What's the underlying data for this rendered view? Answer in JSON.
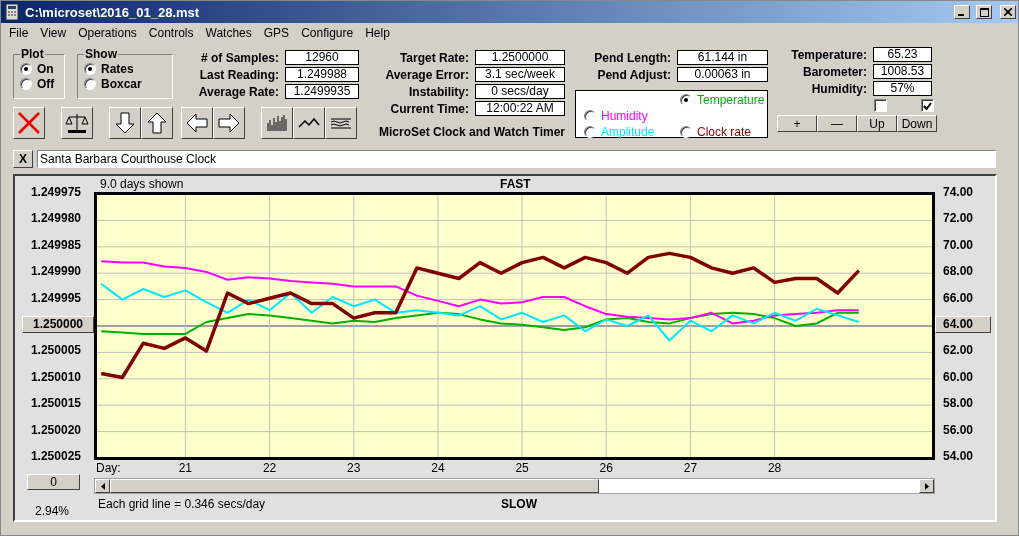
{
  "window": {
    "title": "C:\\microset\\2016_01_28.mst"
  },
  "menu": [
    "File",
    "View",
    "Operations",
    "Controls",
    "Watches",
    "GPS",
    "Configure",
    "Help"
  ],
  "plot_group": {
    "title": "Plot",
    "options": [
      {
        "label": "On",
        "selected": true
      },
      {
        "label": "Off",
        "selected": false
      }
    ]
  },
  "show_group": {
    "title": "Show",
    "options": [
      {
        "label": "Rates",
        "selected": true
      },
      {
        "label": "Boxcar",
        "selected": false
      }
    ]
  },
  "stats": [
    {
      "label": "# of Samples:",
      "value": "12960"
    },
    {
      "label": "Last Reading:",
      "value": "1.249988"
    },
    {
      "label": "Average Rate:",
      "value": "1.2499935"
    }
  ],
  "toolbar": [
    {
      "kind": "delete"
    },
    {
      "kind": "balance"
    },
    {
      "kind": "down"
    },
    {
      "kind": "up"
    },
    {
      "kind": "left"
    },
    {
      "kind": "right"
    },
    {
      "kind": "bars"
    },
    {
      "kind": "zigzag"
    },
    {
      "kind": "waves"
    }
  ],
  "rates": [
    {
      "label": "Target Rate:",
      "value": "1.2500000"
    },
    {
      "label": "Average Error:",
      "value": "3.1 sec/week"
    },
    {
      "label": "Instability:",
      "value": "0 secs/day"
    },
    {
      "label": "Current Time:",
      "value": "12:00:22 AM"
    }
  ],
  "app_name": "MicroSet Clock and Watch Timer",
  "pendulum": [
    {
      "label": "Pend Length:",
      "value": "61.144 in"
    },
    {
      "label": "Pend Adjust:",
      "value": "0.00063 in"
    }
  ],
  "series_select": [
    {
      "selected": true
    },
    {
      "selected": false
    },
    {
      "selected": false
    },
    {
      "selected": false
    }
  ],
  "sensors": [
    {
      "label": "Temperature:",
      "value": "65.23"
    },
    {
      "label": "Barometer:",
      "value": "1008.53"
    },
    {
      "label": "Humidity:",
      "value": "57%"
    }
  ],
  "checkboxes": [
    {
      "checked": false
    },
    {
      "checked": true
    }
  ],
  "adjust_buttons": [
    "+",
    "—",
    "Up",
    "Down"
  ],
  "clock_name": {
    "close": "X",
    "value": "Santa Barbara Courthouse Clock"
  },
  "chart": {
    "days_shown": "9.0 days shown",
    "top_label": "FAST",
    "bottom_label": "SLOW",
    "grid_note": "Each grid line = 0.346 secs/day",
    "percent": "2.94%",
    "offset_button": "0",
    "left_axis": [
      {
        "label": "1.249975",
        "kind": "text"
      },
      {
        "label": "1.249980",
        "kind": "text"
      },
      {
        "label": "1.249985",
        "kind": "text"
      },
      {
        "label": "1.249990",
        "kind": "text"
      },
      {
        "label": "1.249995",
        "kind": "text"
      },
      {
        "label": "1.250000",
        "kind": "button"
      },
      {
        "label": "1.250005",
        "kind": "text"
      },
      {
        "label": "1.250010",
        "kind": "text"
      },
      {
        "label": "1.250015",
        "kind": "text"
      },
      {
        "label": "1.250020",
        "kind": "text"
      },
      {
        "label": "1.250025",
        "kind": "text"
      }
    ],
    "chart_data": {
      "type": "line",
      "xlabel": "Day:",
      "grid": true,
      "ref_lines": [
        {
          "axis": "y",
          "value": 64
        }
      ],
      "xlim": [
        19.95,
        29.87
      ],
      "ylim": [
        54,
        74
      ],
      "xticks": [
        21,
        22,
        23,
        24,
        25,
        26,
        27,
        28
      ],
      "yticks": [
        {
          "value": 74,
          "label": "74.00"
        },
        {
          "value": 72,
          "label": "72.00"
        },
        {
          "value": 70,
          "label": "70.00"
        },
        {
          "value": 68,
          "label": "68.00"
        },
        {
          "value": 66,
          "label": "66.00"
        },
        {
          "value": 64,
          "label": "64.00"
        },
        {
          "value": 62,
          "label": "62.00"
        },
        {
          "value": 60,
          "label": "60.00"
        },
        {
          "value": 58,
          "label": "58.00"
        },
        {
          "value": 56,
          "label": "56.00"
        },
        {
          "value": 54,
          "label": "54.00"
        }
      ],
      "x": [
        20,
        20.25,
        20.5,
        20.75,
        21,
        21.25,
        21.5,
        21.75,
        22,
        22.25,
        22.5,
        22.75,
        23,
        23.25,
        23.5,
        23.75,
        24,
        24.25,
        24.5,
        24.75,
        25,
        25.25,
        25.5,
        25.75,
        26,
        26.25,
        26.5,
        26.75,
        27,
        27.25,
        27.5,
        27.75,
        28,
        28.25,
        28.5,
        28.75,
        29
      ],
      "series": [
        {
          "name": "Temperature",
          "color": "#00b000",
          "values": [
            63.6,
            63.5,
            63.4,
            63.4,
            63.4,
            64.3,
            64.6,
            64.9,
            64.8,
            64.6,
            64.4,
            64.2,
            64.4,
            64.3,
            64.6,
            64.8,
            65.0,
            64.9,
            64.5,
            64.2,
            64.1,
            63.9,
            63.7,
            63.9,
            64.5,
            64.6,
            64.3,
            64.2,
            64.6,
            64.9,
            65.0,
            64.9,
            64.6,
            64.0,
            64.2,
            65.0,
            65.0
          ]
        },
        {
          "name": "Humidity",
          "color": "#ff00ff",
          "values": [
            68.9,
            68.8,
            68.8,
            68.5,
            68.4,
            68.1,
            67.5,
            67.7,
            67.6,
            67.4,
            67.3,
            67.2,
            67.0,
            67.0,
            67.0,
            66.3,
            65.9,
            65.5,
            66.0,
            65.7,
            65.8,
            66.2,
            66.2,
            65.5,
            64.9,
            64.7,
            64.6,
            64.5,
            64.6,
            65.0,
            64.2,
            64.4,
            64.8,
            64.9,
            65.0,
            65.2,
            65.2
          ]
        },
        {
          "name": "Amplitude",
          "color": "#00e8ff",
          "values": [
            67.2,
            66.0,
            66.8,
            66.2,
            66.7,
            65.8,
            65.0,
            66.0,
            65.2,
            66.5,
            65.0,
            66.2,
            65.5,
            66.0,
            65.0,
            65.2,
            65.0,
            64.8,
            65.5,
            64.5,
            65.0,
            64.3,
            64.8,
            63.6,
            64.5,
            64.0,
            64.8,
            62.9,
            64.4,
            63.6,
            64.8,
            64.2,
            65.0,
            64.4,
            65.3,
            64.8,
            64.3
          ]
        },
        {
          "name": "Clock rate",
          "color": "#800000",
          "values": [
            60.4,
            60.1,
            62.7,
            62.3,
            63.1,
            62.1,
            66.5,
            65.7,
            66.1,
            66.5,
            65.7,
            65.7,
            64.6,
            65.0,
            65.0,
            68.4,
            68.0,
            67.6,
            68.8,
            68.0,
            68.8,
            69.2,
            68.4,
            69.2,
            68.8,
            68.0,
            69.2,
            69.5,
            69.2,
            68.4,
            68.0,
            68.4,
            67.3,
            67.6,
            67.6,
            66.5,
            68.2
          ]
        }
      ]
    }
  }
}
